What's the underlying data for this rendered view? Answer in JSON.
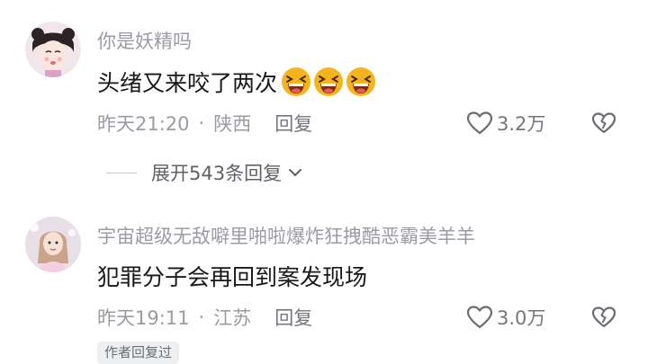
{
  "comments": [
    {
      "username": "你是妖精吗",
      "text": "头绪又来咬了两次",
      "emoji": [
        "laughing-emoji",
        "laughing-emoji",
        "laughing-emoji"
      ],
      "time": "昨天21:20",
      "location": "陕西",
      "reply_label": "回复",
      "likes": "3.2万"
    },
    {
      "username": "宇宙超级无敌噼里啪啦爆炸狂拽酷恶霸美羊羊",
      "text": "犯罪分子会再回到案发现场",
      "time": "昨天19:11",
      "location": "江苏",
      "reply_label": "回复",
      "likes": "3.0万",
      "badge": "作者回复过"
    }
  ],
  "expand_replies": "展开543条回复",
  "separator": "·",
  "colors": {
    "meta_gray": "#9a9ca3",
    "text_dark": "#17181c",
    "emoji_yellow": "#f6b41c"
  },
  "icons": [
    "heart-outline-icon",
    "broken-heart-icon",
    "chevron-down-icon"
  ]
}
